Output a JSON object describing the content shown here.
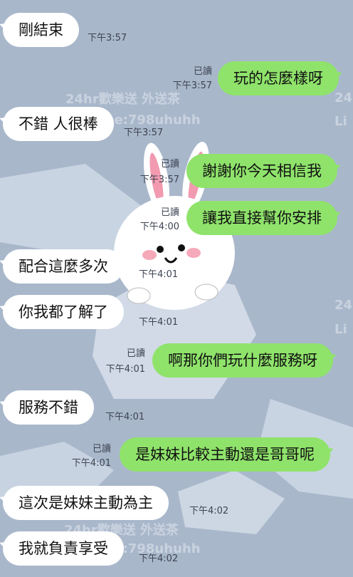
{
  "chat": {
    "messages": [
      {
        "side": "in",
        "text": "剛結束",
        "time": "下午3:57"
      },
      {
        "side": "out",
        "text": "玩的怎麼樣呀",
        "read": "已讀",
        "time": "下午3:57"
      },
      {
        "side": "in",
        "text": "不錯 人很棒",
        "time": "下午3:57"
      },
      {
        "side": "out",
        "text": "謝謝你今天相信我",
        "read": "已讀",
        "time": "下午3:57"
      },
      {
        "side": "out",
        "text": "讓我直接幫你安排",
        "read": "已讀",
        "time": "下午4:00"
      },
      {
        "side": "in",
        "text": "配合這麼多次",
        "time": "下午4:01"
      },
      {
        "side": "in",
        "text": "你我都了解了",
        "time": "下午4:01"
      },
      {
        "side": "out",
        "text": "啊那你們玩什麼服務呀",
        "read": "已讀",
        "time": "下午4:01"
      },
      {
        "side": "in",
        "text": "服務不錯",
        "time": "下午4:01"
      },
      {
        "side": "out",
        "text": "是妹妹比較主動還是哥哥呢",
        "read": "已讀",
        "time": "下午4:01"
      },
      {
        "side": "in",
        "text": "這次是妹妹主動為主",
        "time": "下午4:02"
      },
      {
        "side": "in",
        "text": "我就負責享受",
        "time": "下午4:02"
      }
    ]
  },
  "watermarks": {
    "line1": "24hr歡樂送 外送茶",
    "line2": "Line:798uhuhh",
    "edge1": "24",
    "edge2": "Li"
  },
  "colors": {
    "background": "#a9b7cb",
    "incoming_bubble": "#ffffff",
    "outgoing_bubble": "#8fe36b"
  },
  "icons": [
    "rabbit-sticker-wallpaper"
  ]
}
